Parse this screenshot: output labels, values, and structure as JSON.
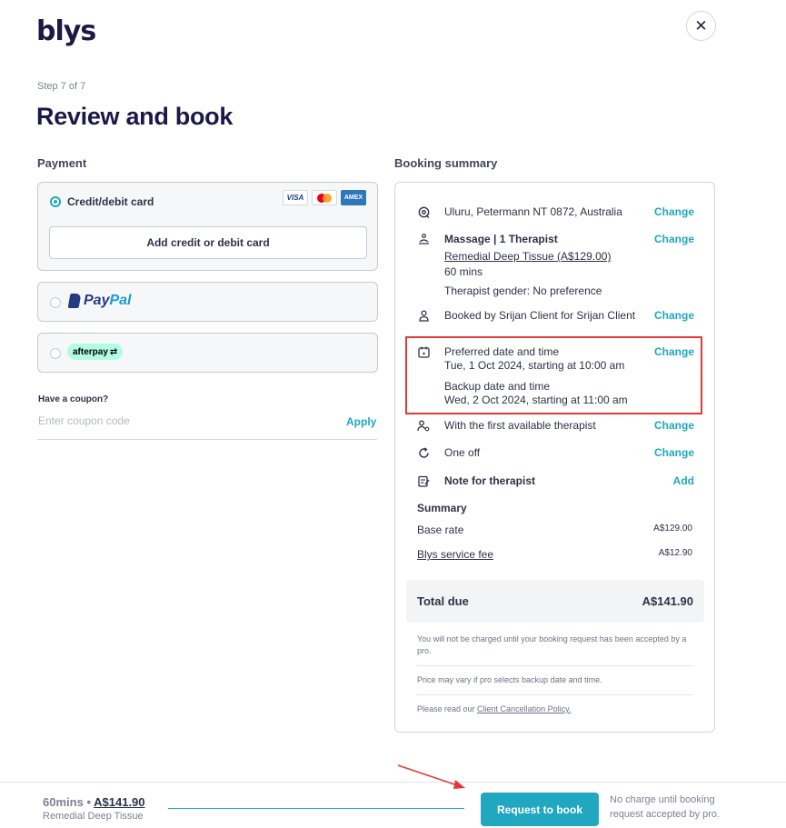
{
  "header": {
    "logo_text": "blys",
    "close_label": "✕"
  },
  "step": "Step 7 of 7",
  "title": "Review and book",
  "payment": {
    "label": "Payment",
    "credit_card_label": "Credit/debit card",
    "card_brands": [
      "VISA",
      "Mastercard",
      "AMEX"
    ],
    "add_card_label": "Add credit or debit card",
    "paypal_label_1": "Pay",
    "paypal_label_2": "Pal",
    "afterpay_label": "afterpay"
  },
  "coupon": {
    "label": "Have a coupon?",
    "placeholder": "Enter coupon code",
    "apply_label": "Apply"
  },
  "summary": {
    "label": "Booking summary",
    "location": "Uluru, Petermann NT 0872, Australia",
    "massage_title": "Massage | 1 Therapist",
    "treatment": "Remedial Deep Tissue (A$129.00)",
    "duration": "60 mins",
    "gender": "Therapist gender: No preference",
    "booked_by": "Booked by Srijan Client for Srijan Client",
    "preferred_label": "Preferred date and time",
    "preferred_value": "Tue, 1 Oct 2024, starting at 10:00 am",
    "backup_label": "Backup date and time",
    "backup_value": "Wed, 2 Oct 2024, starting at 11:00 am",
    "therapist": "With the first available therapist",
    "frequency": "One off",
    "note_label": "Note for therapist",
    "change_label": "Change",
    "add_label": "Add",
    "summary_title": "Summary",
    "base_rate_label": "Base rate",
    "base_rate_value": "A$129.00",
    "service_fee_label": "Blys service fee",
    "service_fee_value": "A$12.90",
    "total_label": "Total due",
    "total_value": "A$141.90",
    "note_charge": "You will not be charged until your booking request has been accepted by a pro.",
    "note_price": "Price may vary if pro selects backup date and time.",
    "policy_prefix": "Please read our ",
    "policy_link": "Client Cancellation Policy."
  },
  "footer": {
    "duration": "60mins",
    "separator": "•",
    "price": "A$141.90",
    "service": "Remedial Deep Tissue",
    "book_label": "Request to book",
    "note": "No charge until booking request accepted by pro."
  },
  "colors": {
    "accent": "#22a7c0",
    "brand": "#1c1847",
    "highlight": "#e03b3b"
  },
  "icons": [
    "location-icon",
    "massage-icon",
    "person-icon",
    "calendar-icon",
    "therapist-icon",
    "repeat-icon",
    "note-icon"
  ]
}
